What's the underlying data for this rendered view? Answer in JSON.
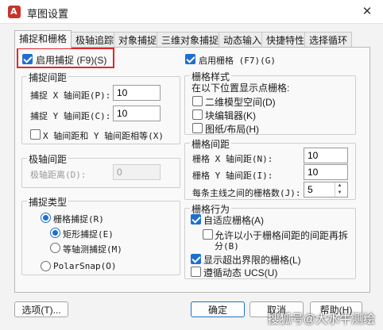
{
  "window": {
    "title": "草图设置",
    "app_icon_glyph": "A",
    "close_glyph": "✕"
  },
  "tabs": [
    {
      "label": "捕捉和栅格"
    },
    {
      "label": "极轴追踪"
    },
    {
      "label": "对象捕捉"
    },
    {
      "label": "三维对象捕捉"
    },
    {
      "label": "动态输入"
    },
    {
      "label": "快捷特性"
    },
    {
      "label": "选择循环"
    }
  ],
  "snap": {
    "enable_label": "启用捕捉 (F9)(S)",
    "enabled": true,
    "spacing_group": "捕捉间距",
    "x_label": "捕捉 X 轴间距(P):",
    "x_value": "10",
    "y_label": "捕捉 Y 轴间距(C):",
    "y_value": "10",
    "equal_label": "X 轴间距和 Y 轴间距相等(X)",
    "equal_checked": false
  },
  "polar": {
    "group": "极轴间距",
    "distance_label": "极轴距离(D):",
    "distance_value": "0"
  },
  "snap_type": {
    "group": "捕捉类型",
    "grid_snap": "栅格捕捉(R)",
    "rect_snap": "矩形捕捉(E)",
    "iso_snap": "等轴测捕捉(M)",
    "polar_snap": "PolarSnap(O)",
    "selected_main": "grid_snap",
    "selected_sub": "rect_snap"
  },
  "grid": {
    "enable_label": "启用栅格 (F7)(G)",
    "enabled": true,
    "style_group": "栅格样式",
    "style_desc": "在以下位置显示点栅格:",
    "style_2d": "二维模型空间(D)",
    "style_block": "块编辑器(K)",
    "style_sheet": "图纸/布局(H)",
    "spacing_group": "栅格间距",
    "x_label": "栅格 X 轴间距(N):",
    "x_value": "10",
    "y_label": "栅格 Y 轴间距(I):",
    "y_value": "10",
    "major_label": "每条主线之间的栅格数(J):",
    "major_value": "5",
    "behavior_group": "栅格行为",
    "adaptive": "自适应栅格(A)",
    "adaptive_checked": true,
    "subdivide_line1": "允许以小于栅格间距的间距再拆",
    "subdivide_line2": "分(B)",
    "subdivide_checked": false,
    "beyond": "显示超出界限的栅格(L)",
    "beyond_checked": true,
    "follow_ucs": "遵循动态 UCS(U)",
    "follow_checked": false
  },
  "buttons": {
    "options": "选项(T)...",
    "ok": "确定",
    "cancel": "取消",
    "help": "帮助(H)"
  },
  "watermark": "搜狐号@大水牛测绘",
  "colors": {
    "accent": "#1e6fd1",
    "highlight": "#e0262b"
  }
}
